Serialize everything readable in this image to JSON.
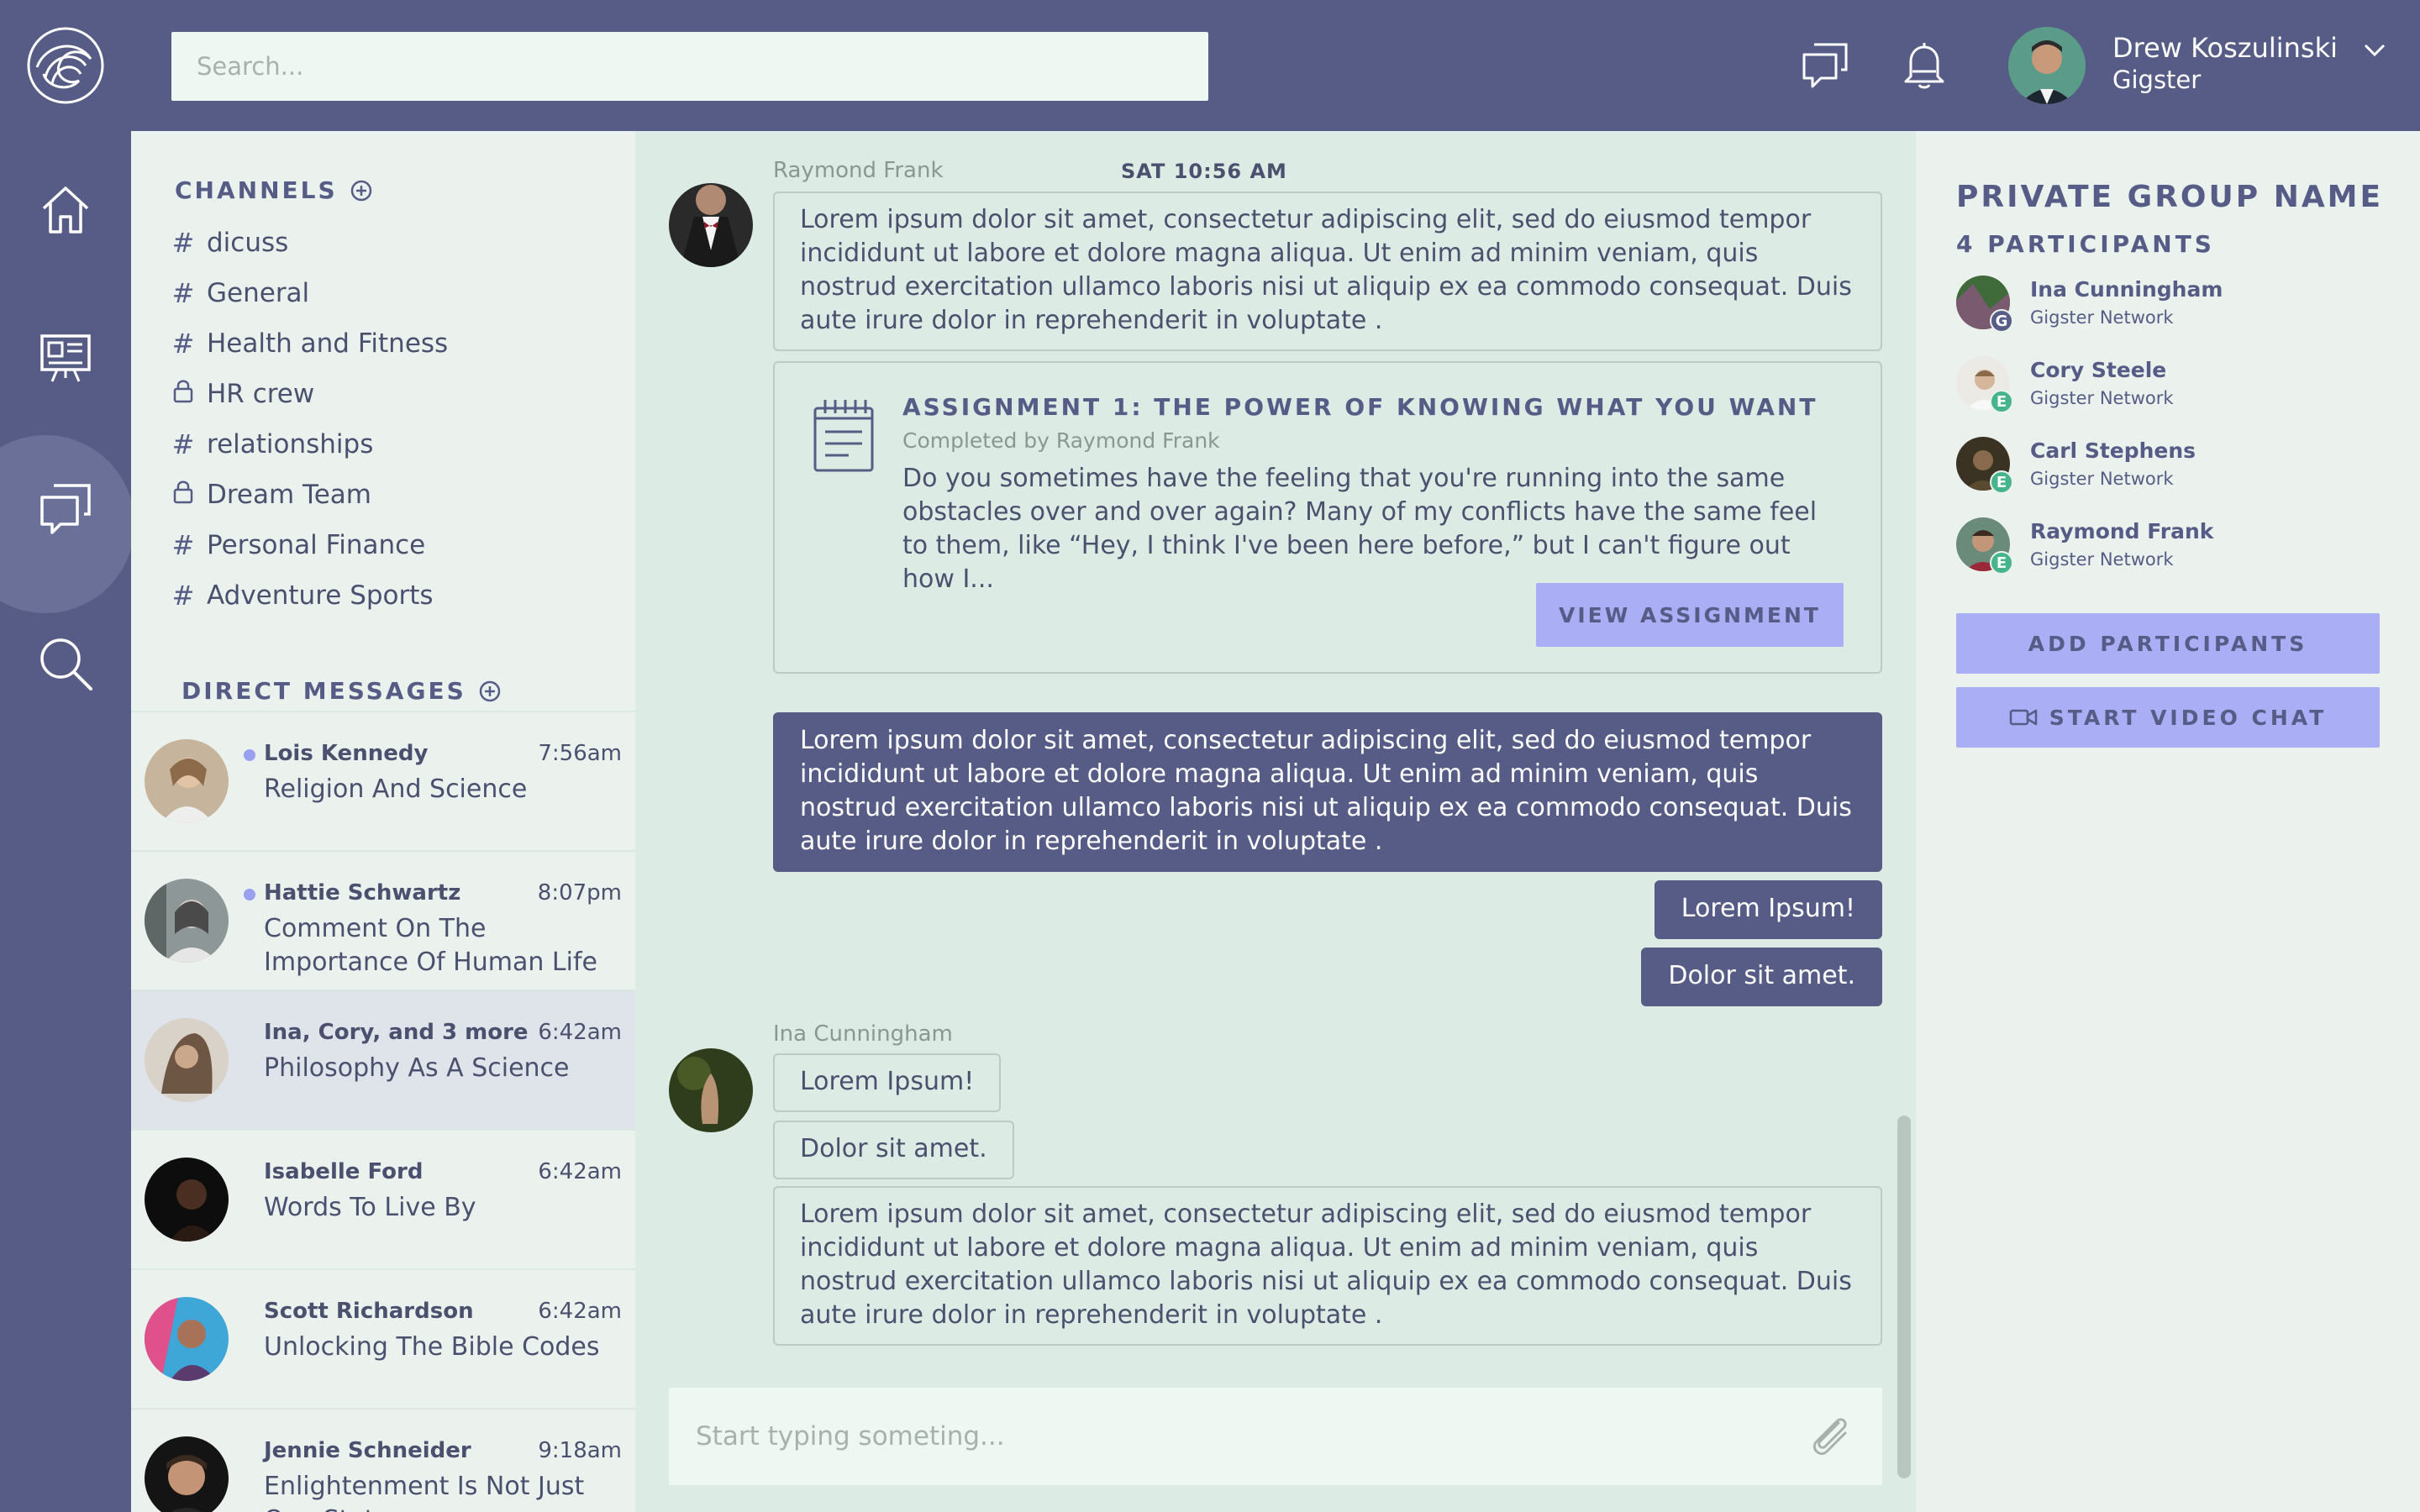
{
  "header": {
    "search_placeholder": "Search...",
    "user_name": "Drew Koszulinski",
    "user_role": "Gigster"
  },
  "channels": {
    "title": "CHANNELS",
    "items": [
      {
        "label": "dicuss",
        "icon": "hash-icon"
      },
      {
        "label": "General",
        "icon": "hash-icon"
      },
      {
        "label": "Health and Fitness",
        "icon": "hash-icon"
      },
      {
        "label": "HR crew",
        "icon": "lock-icon"
      },
      {
        "label": "relationships",
        "icon": "hash-icon"
      },
      {
        "label": "Dream Team",
        "icon": "lock-icon"
      },
      {
        "label": "Personal Finance",
        "icon": "hash-icon"
      },
      {
        "label": "Adventure Sports",
        "icon": "hash-icon"
      }
    ]
  },
  "direct_messages": {
    "title": "DIRECT MESSAGES",
    "items": [
      {
        "name": "Lois Kennedy",
        "time": "7:56am",
        "preview": "Religion And Science",
        "unread": true
      },
      {
        "name": "Hattie Schwartz",
        "time": "8:07pm",
        "preview": "Comment On The Importance Of Human Life",
        "unread": true
      },
      {
        "name": "Ina, Cory, and 3 more",
        "time": "6:42am",
        "preview": "Philosophy As A Science",
        "unread": false
      },
      {
        "name": "Isabelle Ford",
        "time": "6:42am",
        "preview": "Words To Live By",
        "unread": false
      },
      {
        "name": "Scott Richardson",
        "time": "6:42am",
        "preview": "Unlocking The Bible Codes",
        "unread": false
      },
      {
        "name": "Jennie Schneider",
        "time": "9:18am",
        "preview": "Enlightenment Is Not Just One State",
        "unread": false
      }
    ]
  },
  "chat": {
    "first_sender": "Raymond Frank",
    "first_stamp": "SAT 10:56 AM",
    "first_message": "Lorem ipsum dolor sit amet, consectetur adipiscing elit, sed do eiusmod tempor incididunt ut labore et dolore magna aliqua. Ut enim ad minim veniam, quis nostrud exercitation ullamco laboris nisi ut aliquip ex ea commodo consequat. Duis aute irure dolor in reprehenderit in voluptate .",
    "assignment": {
      "title": "ASSIGNMENT 1: THE POWER OF KNOWING WHAT YOU WANT",
      "subtitle": "Completed by Raymond Frank",
      "body": "Do you sometimes have the feeling that you're running into the same obstacles over and over again? Many of my conflicts have the same feel to them, like “Hey, I think I've been here before,” but I can't figure out how I...",
      "button": "VIEW ASSIGNMENT"
    },
    "own_long": "Lorem ipsum dolor sit amet, consectetur adipiscing elit, sed do eiusmod tempor incididunt ut labore et dolore magna aliqua. Ut enim ad minim veniam, quis nostrud exercitation ullamco laboris nisi ut aliquip ex ea commodo consequat. Duis aute irure dolor in reprehenderit in voluptate .",
    "own_short_1": "Lorem Ipsum!",
    "own_short_2": "Dolor sit amet.",
    "second_sender": "Ina Cunningham",
    "second_short_1": "Lorem Ipsum!",
    "second_short_2": "Dolor sit amet.",
    "second_long": "Lorem ipsum dolor sit amet, consectetur adipiscing elit, sed do eiusmod tempor incididunt ut labore et dolore magna aliqua. Ut enim ad minim veniam, quis nostrud exercitation ullamco laboris nisi ut aliquip ex ea commodo consequat. Duis aute irure dolor in reprehenderit in voluptate .",
    "compose_placeholder": "Start typing someting..."
  },
  "panel": {
    "title": "PRIVATE GROUP NAME",
    "count": "4 PARTICIPANTS",
    "participants": [
      {
        "name": "Ina Cunningham",
        "network": "Gigster Network",
        "badge": "G"
      },
      {
        "name": "Cory Steele",
        "network": "Gigster Network",
        "badge": "E"
      },
      {
        "name": "Carl Stephens",
        "network": "Gigster Network",
        "badge": "E"
      },
      {
        "name": "Raymond Frank",
        "network": "Gigster Network",
        "badge": "E"
      }
    ],
    "add_button": "ADD PARTICIPANTS",
    "video_button": "START VIDEO CHAT"
  },
  "colors": {
    "brand": "#565c85",
    "accent": "#a9aef5",
    "chat_bg": "#dcebe4",
    "sidebar_bg": "#ebf2ee"
  }
}
